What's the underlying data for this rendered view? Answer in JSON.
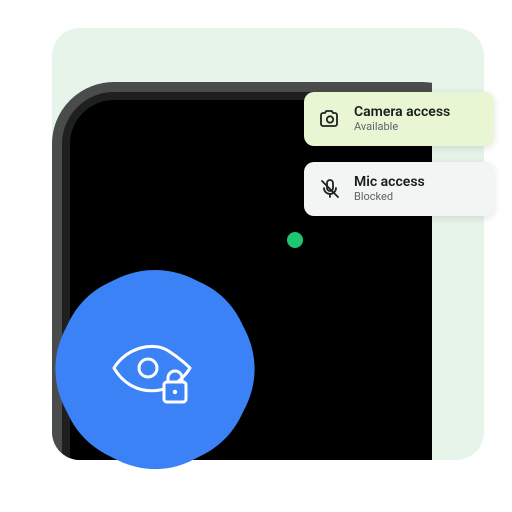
{
  "camera": {
    "title": "Camera access",
    "status": "Available"
  },
  "mic": {
    "title": "Mic access",
    "status": "Blocked"
  },
  "colors": {
    "accent_blue": "#3b82f6",
    "indicator_green": "#1ec772"
  }
}
